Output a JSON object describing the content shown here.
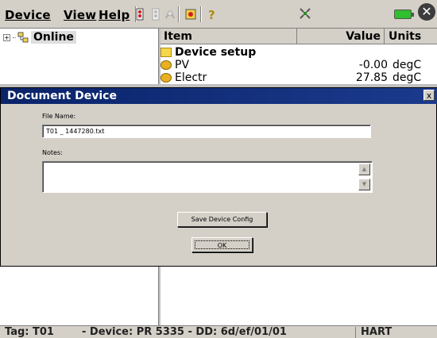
{
  "menu": {
    "device": "Device",
    "view": "View",
    "help": "Help"
  },
  "toolbar": {
    "icons": [
      "connect-icon",
      "disconnect-icon",
      "poll-icon",
      "device-icon",
      "help-icon"
    ],
    "hart_indicator_icon": "hart-activity-icon",
    "battery_icon": "battery-icon",
    "close_glyph": "✕"
  },
  "tree": {
    "expander": "+",
    "root_label": "Online"
  },
  "list": {
    "headers": {
      "item": "Item",
      "value": "Value",
      "units": "Units"
    },
    "rows": [
      {
        "name": "Device setup",
        "value": "",
        "unit": "",
        "icon": "folder-icon"
      },
      {
        "name": "PV",
        "value": "-0.00",
        "unit": "degC",
        "icon": "variable-icon"
      },
      {
        "name": "Electr",
        "value": "27.85",
        "unit": "degC",
        "icon": "variable-icon"
      }
    ]
  },
  "dialog": {
    "title": "Document Device",
    "close_glyph": "x",
    "file_name_label": "File Name:",
    "file_name_value": "T01   _   1447280.txt",
    "notes_label": "Notes:",
    "notes_value": "",
    "save_button": "Save Device Config",
    "ok_button": "OK"
  },
  "status": {
    "tag": "Tag: T01",
    "device": "- Device: PR 5335 - DD: 6d/ef/01/01",
    "protocol": "HART"
  }
}
